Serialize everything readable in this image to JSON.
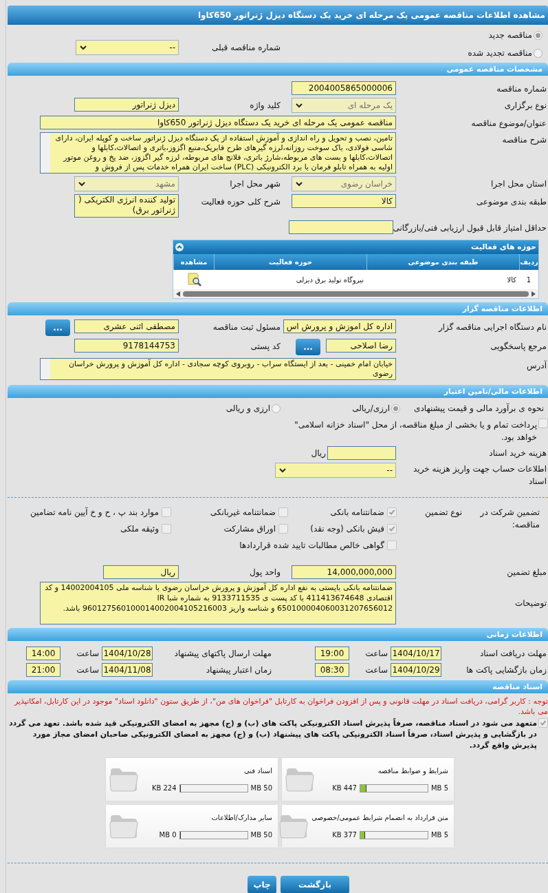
{
  "title": "مشاهده اطلاعات مناقصه عمومی یک مرحله ای خرید یک دستگاه دیزل ژنراتور 650کاوا",
  "tender_type": [
    {
      "label": "مناقصه جدید",
      "selected": true
    },
    {
      "label": "مناقصه تجدید شده",
      "selected": false
    }
  ],
  "previous_tender": {
    "label": "شماره مناقصه قبلی",
    "value": "--"
  },
  "general": {
    "header": "مشخصات مناقصه عمومی",
    "rows": [
      [
        {
          "label": "شماره مناقصه",
          "value": "2004005865000006",
          "kind": "input"
        }
      ],
      [
        {
          "label": "نوع برگزاری",
          "value": "یک مرحله ای",
          "kind": "select",
          "disabled": true
        },
        {
          "label": "کلید واژه",
          "value": "دیزل ژنراتور",
          "kind": "input"
        }
      ],
      [
        {
          "label": "عنوان/موضوع مناقصه",
          "value": "مناقصه عمومی یک مرحله ای خرید یک دستگاه دیزل ژنراتور 650کاوا",
          "kind": "wide_input"
        }
      ],
      [
        {
          "label": "شرح مناقصه",
          "value": "تامین، نصب و تحویل و راه اندازی و آموزش استفاده از یک دستگاه دیزل ژنراتور ساخت و کوپله ایران، دارای شاسی فولادی، باک سوخت روزانه،لرزه گیرهای طرح فابریک،منبع اگزوز،باتری و اتصالات،کابلها و اتصالات،کابلها و بست های مربوطه،شارژ باتری، فلانج های مربوطه، لرزه گیر اگزوز، ضد یخ و روغن موتور اولیه به همراه تابلو فرمان با برد الکترونیکی (PLC) ساخت ایران  همراه خدمات پس از فروش و",
          "kind": "wide_area"
        }
      ],
      [
        {
          "label": "استان محل اجرا",
          "value": "خراسان رضوی",
          "kind": "select",
          "disabled": true
        },
        {
          "label": "شهر محل اجرا",
          "value": "مشهد",
          "kind": "select",
          "disabled": true
        }
      ],
      [
        {
          "label": "طبقه بندی موضوعی",
          "value": "کالا",
          "kind": "input"
        },
        {
          "label": "شرح کلی حوزه فعالیت",
          "value": "تولید کننده انرژی الکتریکی ( ژنراتور برق)",
          "kind": "area"
        }
      ],
      [
        {
          "label": "حداقل امتیاز قابل قبول ارزیابی فنی/بازرگانی",
          "kind": "input"
        }
      ]
    ]
  },
  "activities": {
    "title": "حوزه های فعالیت",
    "columns": [
      "ردیف",
      "طبقه بندی موضوعی",
      "حوزه فعالیت",
      "مشاهده"
    ],
    "rows": [
      {
        "cells": [
          "1",
          "کالا",
          "نیروگاه تولید برق دیزلی"
        ]
      }
    ]
  },
  "organizer": {
    "header": "اطلاعات مناقصه گزار",
    "rows": [
      [
        {
          "label": "نام دستگاه اجرایی مناقصه گزار",
          "value": "اداره کل اموزش و پرورش اس",
          "kind": "input"
        },
        {
          "label": "مسئول ثبت مناقصه",
          "value": "مصطفی اثنی عشری",
          "kind": "input",
          "button": "..."
        }
      ],
      [
        {
          "label": "مرجع پاسخگویی",
          "value": "رضا اصلاحی",
          "kind": "input",
          "button": "..."
        },
        {
          "label": "کد پستی",
          "value": "9178144753",
          "kind": "input"
        }
      ],
      [
        {
          "label": "آدرس",
          "value": "خیابان امام خمینی - بعد از ایستگاه سراب - روبروی کوچه سجادی - اداره کل آموزش و پرورش خراسان رضوی",
          "kind": "wide_area"
        }
      ]
    ]
  },
  "finance": {
    "header": "اطلاعات مالی/تامین اعتبار",
    "estimate": {
      "label": "نحوه ی برآورد مالی و قیمت پیشنهادی",
      "options": [
        {
          "label": "ارزی/ریالی",
          "selected": true
        },
        {
          "label": "ارزی و ریالی",
          "selected": false
        }
      ]
    },
    "treasury": {
      "label": "پرداخت تمام و یا بخشی از مبلغ مناقصه، از محل \"اسناد خزانه اسلامی\" خواهد بود.",
      "checked": false
    },
    "doc_fee": {
      "label": "هزینه خرید اسناد",
      "unit": "ریال"
    },
    "account": {
      "label": "اطلاعات حساب جهت واریز هزینه خرید اسناد",
      "value": "--"
    },
    "guarantee": {
      "label": "تضمین شرکت در مناقصه:",
      "type_label": "نوع تضمین",
      "options": [
        {
          "label": "ضمانتنامه بانکی",
          "checked": true
        },
        {
          "label": "ضمانتنامه غیربانکی",
          "checked": false
        },
        {
          "label": "موارد بند پ ، ح و خ آیین نامه تضامین",
          "checked": false
        },
        {
          "label": "فیش بانکی (وجه نقد)",
          "checked": true
        },
        {
          "label": "اوراق مشارکت",
          "checked": false
        },
        {
          "label": "وثیقه ملکی",
          "checked": false
        },
        {
          "label": "گواهی خالص مطالبات تایید شده قراردادها",
          "checked": false
        }
      ]
    },
    "amount": {
      "label": "مبلغ تضمین",
      "value": "14,000,000,000"
    },
    "currency": {
      "label": "واحد پول",
      "value": "ریال"
    },
    "notes": {
      "label": "توضیحات",
      "value": "ضمانتنامه بانکی بایستی به نفع اداره کل آموزش و پرورش خراسان رضوی با شناسه ملی 14002004105 و کد اقتصادی 411413674648 با کد پست ی 9133711535 به شماره شبا IR 650100004060031207656012 و شناسه واریز 960127560100014002004105216003 باشد."
    }
  },
  "timing": {
    "header": "اطلاعات زمانی",
    "rows": [
      [
        {
          "label": "مهلت دریافت اسناد",
          "date": "1404/10/17",
          "time_label": "ساعت",
          "time": "19:00"
        },
        {
          "label": "مهلت ارسال پاکتهای پیشنهاد",
          "date": "1404/10/28",
          "time_label": "ساعت",
          "time": "14:00"
        }
      ],
      [
        {
          "label": "زمان بازگشایی پاکت ها",
          "date": "1404/10/29",
          "time_label": "ساعت",
          "time": "08:30"
        },
        {
          "label": "زمان اعتبار پیشنهاد",
          "date": "1404/11/08",
          "time_label": "ساعت",
          "time": "21:00"
        }
      ]
    ]
  },
  "documents": {
    "header": "اسناد مناقصه",
    "notice": "توجه : کاربر گرامی، دریافت اسناد در مهلت قانونی و پس از افزودن فراخوان به کارتابل \"فراخوان های من\"، از طریق ستون \"دانلود اسناد\" موجود در این کارتابل، امکانپذیر می باشد.",
    "commitment": {
      "label": "متعهد می شود در اسناد مناقصه، صرفاً پذیرش اسناد الکترونیکی پاکت های (ب) و (ج) مجهز به امضای الکترونیکی قید شده باشد. تعهد می گردد در بازگشایی و پذیرش اسناد، صرفاً اسناد الکترونیکی پاکت های پیشنهاد (ب) و (ج) مجهز به امضای الکترونیکی صاحبان امضای مجاز مورد پذیرش واقع گردد.",
      "checked": true
    },
    "files": [
      {
        "title": "شرایط و ضوابط مناقصه",
        "size": "447 KB",
        "max": "5 MB",
        "level": 0.09
      },
      {
        "title": "اسناد فنی",
        "size": "224 KB",
        "max": "50 MB",
        "level": 0.004
      },
      {
        "title": "متن قرارداد به انضمام شرایط عمومی/خصوصی",
        "size": "377 KB",
        "max": "5 MB",
        "level": 0.075
      },
      {
        "title": "سایر مدارک/اطلاعات",
        "size": "0 MB",
        "max": "50 MB",
        "level": 0
      }
    ]
  },
  "buttons": [
    {
      "label": "بازگشت"
    },
    {
      "label": "چاپ"
    }
  ]
}
